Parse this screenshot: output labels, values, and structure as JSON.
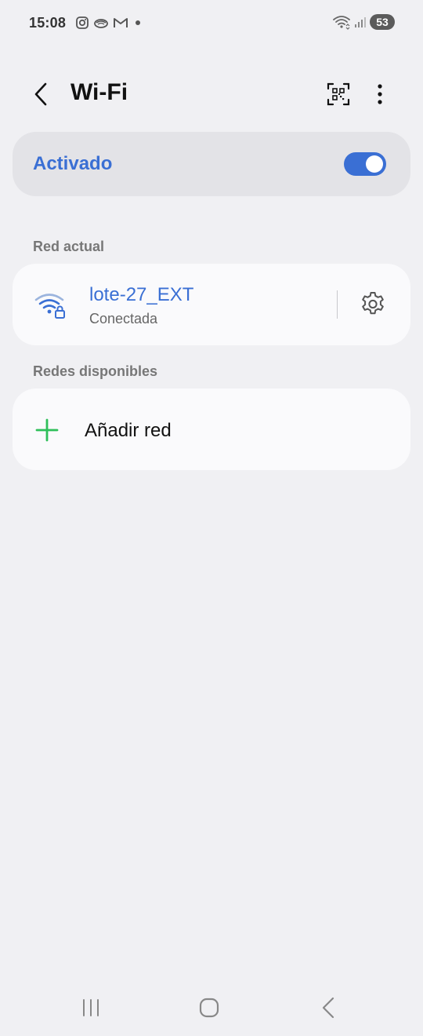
{
  "status_bar": {
    "time": "15:08",
    "battery": "53",
    "notification_icons": [
      "instagram-icon",
      "pigeon-icon",
      "gmail-icon",
      "dot-icon"
    ],
    "system_icons": [
      "wifi-signal-icon",
      "cell-signal-icon",
      "battery-icon"
    ]
  },
  "header": {
    "title": "Wi-Fi",
    "back_icon": "back-chevron-icon",
    "qr_icon": "qr-scan-icon",
    "more_icon": "more-vertical-icon"
  },
  "master_toggle": {
    "label": "Activado",
    "state": "on",
    "accent_color": "#3a6fd4"
  },
  "current_network": {
    "section_title": "Red actual",
    "name": "lote-27_EXT",
    "status": "Conectada",
    "icon": "wifi-lock-icon",
    "settings_icon": "gear-icon"
  },
  "available_networks": {
    "section_title": "Redes disponibles",
    "add_label": "Añadir red",
    "add_icon": "plus-icon",
    "add_icon_color": "#2fbf5a"
  },
  "nav_bar": {
    "icons": [
      "recents-icon",
      "home-icon",
      "back-icon"
    ]
  }
}
